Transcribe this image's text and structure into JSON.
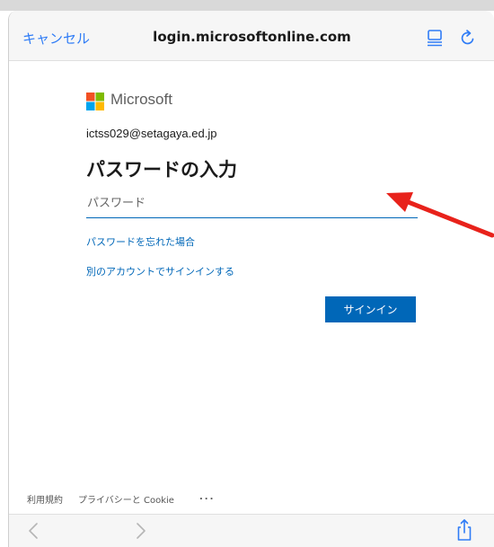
{
  "nav": {
    "cancel_label": "キャンセル",
    "url": "login.microsoftonline.com",
    "reader_icon": "reader-view-icon",
    "reload_icon": "reload-icon"
  },
  "login": {
    "brand": "Microsoft",
    "email": "ictss029@setagaya.ed.jp",
    "title": "パスワードの入力",
    "password_placeholder": "パスワード",
    "password_value": "",
    "forgot_link": "パスワードを忘れた場合",
    "other_account_link": "別のアカウントでサインインする",
    "signin_label": "サインイン"
  },
  "footer": {
    "terms": "利用規約",
    "privacy": "プライバシーと Cookie",
    "more": "..."
  },
  "toolbar": {
    "back_icon": "chevron-left-icon",
    "forward_icon": "chevron-right-icon",
    "share_icon": "share-icon"
  },
  "colors": {
    "accent": "#2f7cf6",
    "ms_blue": "#0067b8",
    "annotation_arrow": "#e8221b"
  }
}
